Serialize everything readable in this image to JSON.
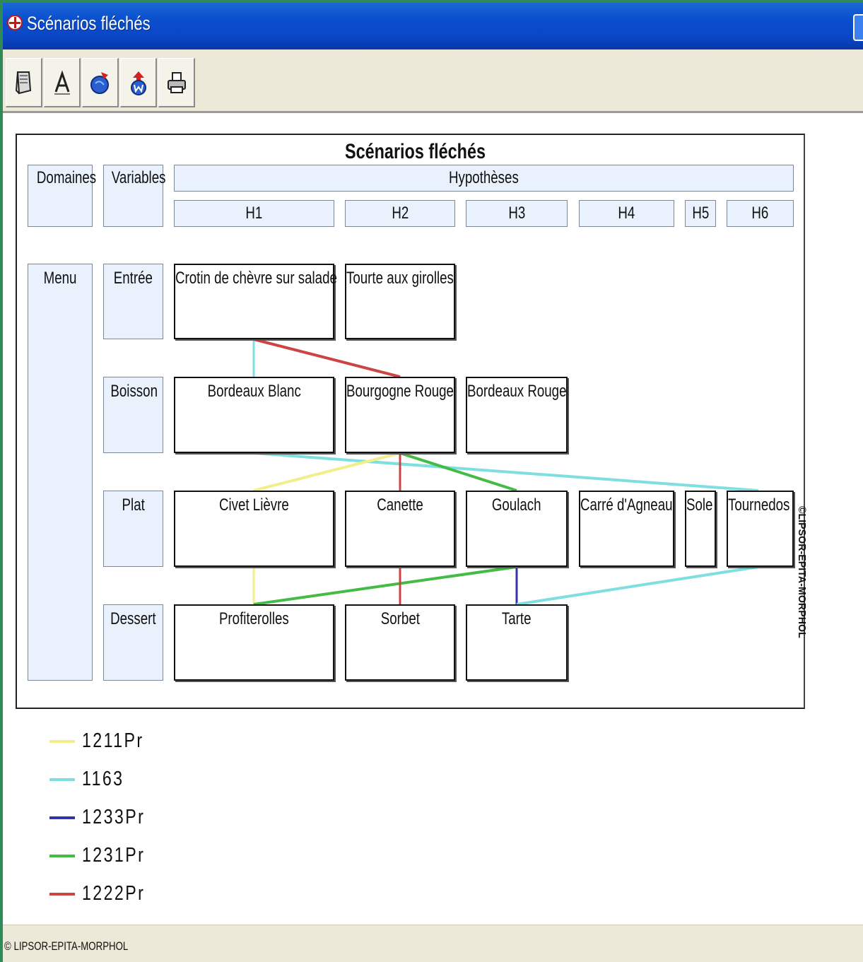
{
  "window": {
    "title": "Scénarios fléchés",
    "status_text": "© LIPSOR-EPITA-MORPHOL"
  },
  "toolbar": {
    "buttons": [
      {
        "icon": "document-icon"
      },
      {
        "icon": "font-icon"
      },
      {
        "icon": "export-icon"
      },
      {
        "icon": "word-export-icon"
      },
      {
        "icon": "print-icon"
      }
    ]
  },
  "diagram": {
    "title": "Scénarios fléchés",
    "copyright": "©LIPSOR-EPITA-MORPHOL",
    "headers": {
      "domaines": "Domaines",
      "variables": "Variables",
      "hypotheses": "Hypothèses",
      "h": [
        "H1",
        "H2",
        "H3",
        "H4",
        "H5",
        "H6"
      ]
    },
    "domain": "Menu",
    "variables": [
      "Entrée",
      "Boisson",
      "Plat",
      "Dessert"
    ],
    "rows": {
      "entree": [
        "Crotin de chèvre sur salade",
        "Tourte aux girolles"
      ],
      "boisson": [
        "Bordeaux Blanc",
        "Bourgogne Rouge",
        "Bordeaux Rouge"
      ],
      "plat": [
        "Civet Lièvre",
        "Canette",
        "Goulach",
        "Carré d'Agneau",
        "Sole",
        "Tournedos"
      ],
      "dessert": [
        "Profiterolles",
        "Sorbet",
        "Tarte"
      ]
    }
  },
  "legend": [
    {
      "label": "1211Pr",
      "color": "#f2ef8a"
    },
    {
      "label": "1163",
      "color": "#7fdfe0"
    },
    {
      "label": "1233Pr",
      "color": "#3333aa"
    },
    {
      "label": "1231Pr",
      "color": "#44bb44"
    },
    {
      "label": "1222Pr",
      "color": "#cc4444"
    }
  ],
  "scenarios": [
    {
      "color": "#f2ef8a",
      "path": [
        "Crotin de chèvre sur salade",
        "Bordeaux Blanc",
        "Civet Lièvre",
        "Profiterolles"
      ]
    },
    {
      "color": "#7fdfe0",
      "path": [
        "Crotin de chèvre sur salade",
        "Bordeaux Blanc",
        "Tournedos",
        "Tarte"
      ]
    },
    {
      "color": "#3333aa",
      "path": [
        "Goulach",
        "Tarte"
      ]
    },
    {
      "color": "#44bb44",
      "path": [
        "Bourgogne Rouge",
        "Goulach",
        "Profiterolles"
      ]
    },
    {
      "color": "#cc4444",
      "path": [
        "Crotin de chèvre sur salade",
        "Bourgogne Rouge",
        "Canette",
        "Sorbet"
      ]
    }
  ]
}
